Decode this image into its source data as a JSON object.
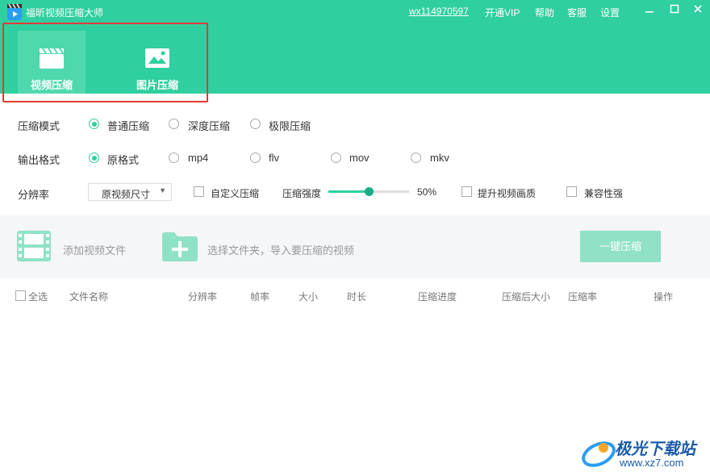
{
  "app": {
    "title": "福昕视频压缩大师",
    "user": "wx114970597",
    "links": [
      "开通VIP",
      "帮助",
      "客服",
      "设置"
    ],
    "window_controls": [
      "minimize",
      "maximize",
      "close"
    ]
  },
  "tabs": [
    {
      "label": "视频压缩",
      "icon": "clapperboard-icon",
      "active": true
    },
    {
      "label": "图片压缩",
      "icon": "image-icon",
      "active": false
    }
  ],
  "compress_mode": {
    "label": "压缩模式",
    "options": [
      "普通压缩",
      "深度压缩",
      "极限压缩"
    ],
    "selected": 0
  },
  "output_format": {
    "label": "输出格式",
    "options": [
      "原格式",
      "mp4",
      "flv",
      "mov",
      "mkv"
    ],
    "selected": 0
  },
  "resolution": {
    "label": "分辨率",
    "selected": "原视频尺寸",
    "custom_label": "自定义压缩",
    "strength_label": "压缩强度",
    "strength_value": "50%",
    "strength": 0.5,
    "enhance_label": "提升视频画质",
    "compat_label": "兼容性强"
  },
  "toolbar": {
    "add_file": "添加视频文件",
    "choose_folder": "选择文件夹，导入要压缩的视频",
    "compress_button": "一键压缩"
  },
  "table": {
    "select_all": "全选",
    "columns": [
      "文件名称",
      "分辨率",
      "帧率",
      "大小",
      "时长",
      "压缩进度",
      "压缩后大小",
      "压缩率",
      "操作"
    ]
  },
  "watermark": {
    "line1": "极光下载站",
    "line2": "www.xz7.com"
  },
  "colors": {
    "brand": "#2fcf9f",
    "button_disabled": "#8fe2c6",
    "highlight": "#e53935"
  }
}
